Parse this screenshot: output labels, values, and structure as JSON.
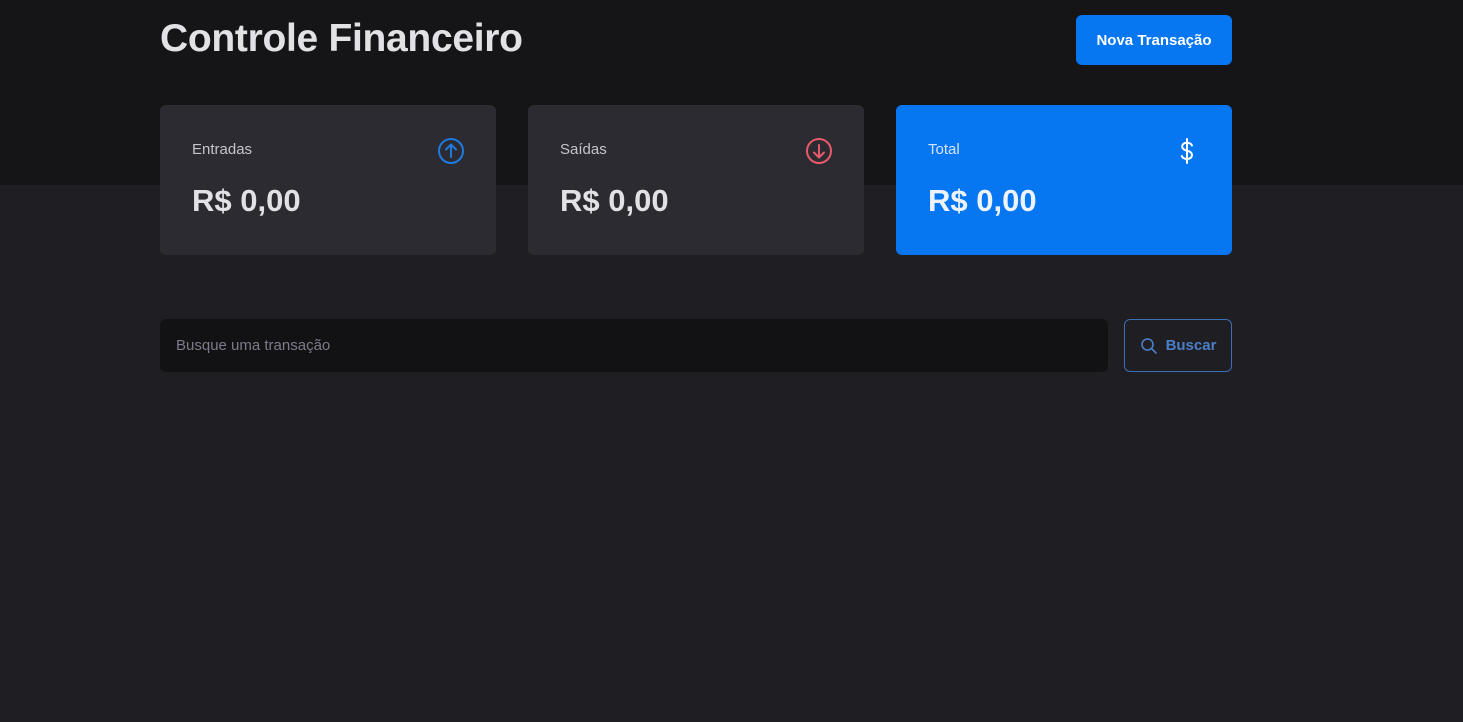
{
  "header": {
    "title": "Controle Financeiro",
    "new_transaction_label": "Nova Transação"
  },
  "summary": {
    "income": {
      "label": "Entradas",
      "value": "R$ 0,00",
      "icon": "arrow-circle-up-icon",
      "icon_color": "#1f7ae0"
    },
    "outcome": {
      "label": "Saídas",
      "value": "R$ 0,00",
      "icon": "arrow-circle-down-icon",
      "icon_color": "#e85a6a"
    },
    "total": {
      "label": "Total",
      "value": "R$ 0,00",
      "icon": "currency-dollar-icon",
      "icon_color": "#ffffff"
    }
  },
  "search": {
    "placeholder": "Busque uma transação",
    "value": "",
    "button_label": "Buscar",
    "icon": "search-icon"
  },
  "colors": {
    "accent": "#0676f1",
    "background": "#1f1e23",
    "header_background": "#151517",
    "card_background": "#2c2b31"
  }
}
